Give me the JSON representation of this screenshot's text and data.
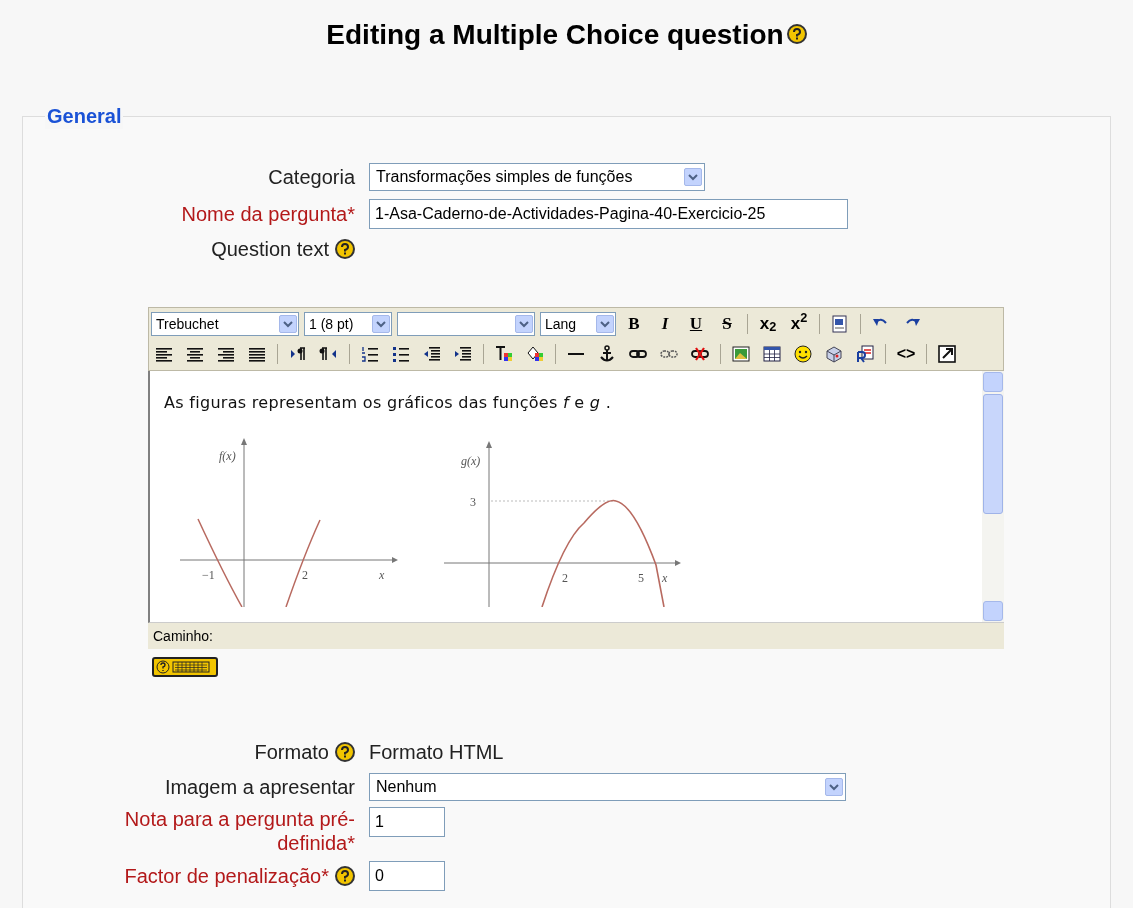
{
  "page_title": "Editing a Multiple Choice question",
  "legend": "General",
  "fields_top": [
    {
      "kind": "select",
      "label": "Categoria",
      "required": false,
      "help": false,
      "value": "Transformações simples de funções"
    },
    {
      "kind": "input",
      "label": "Nome da pergunta*",
      "required": true,
      "help": false,
      "value": "1-Asa-Caderno-de-Actividades-Pagina-40-Exercicio-25"
    },
    {
      "kind": "heading",
      "label": "Question text",
      "required": false,
      "help": true
    }
  ],
  "editor": {
    "selects": [
      {
        "kind": "font",
        "text": "Trebuchet"
      },
      {
        "kind": "size",
        "text": "1 (8 pt)"
      },
      {
        "kind": "style"
      },
      {
        "kind": "lang",
        "text": "Lang"
      }
    ],
    "text_buttons": [
      {
        "kind": "bold",
        "text": "B"
      },
      {
        "kind": "italic",
        "text": "I"
      },
      {
        "kind": "underline",
        "text": "U"
      },
      {
        "kind": "strike",
        "text": "S"
      },
      {
        "kind": "rich",
        "text": "x$_{2}$"
      },
      {
        "kind": "rich",
        "text": "x$^{2}$"
      }
    ],
    "code_button": "<>",
    "content": "As figuras representam os gráficos das funções *f* e *g* .",
    "graph_f": {
      "ylabel": "f(x)",
      "xlabel": "x",
      "ticks": [
        "−1",
        "2"
      ]
    },
    "graph_g": {
      "ylabel": "g(x)",
      "xlabel": "x",
      "ticks": [
        "3",
        "2",
        "5"
      ]
    },
    "path_label": "Caminho:"
  },
  "fields_bottom": [
    {
      "kind": "static",
      "label": "Formato",
      "required": false,
      "help": true,
      "value": "Formato HTML"
    },
    {
      "kind": "wide_select",
      "label": "Imagem a apresentar",
      "required": false,
      "help": false,
      "value": "Nenhum"
    },
    {
      "kind": "small_input",
      "label": "Nota para a pergunta pré-definida*",
      "required": true,
      "help": false,
      "value": "1"
    },
    {
      "kind": "small_input",
      "label": "Factor de penalização*",
      "required": true,
      "help": true,
      "value": "0"
    }
  ]
}
